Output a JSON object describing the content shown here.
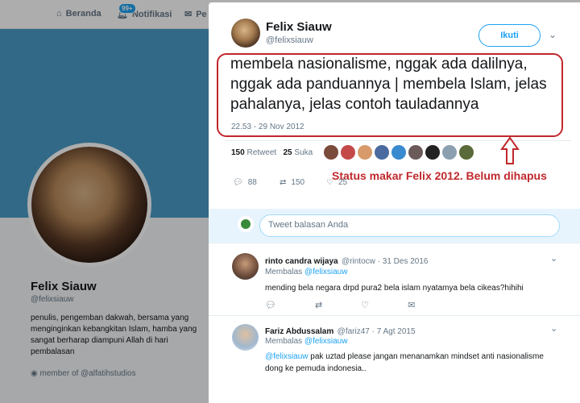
{
  "nav": {
    "home": "Beranda",
    "notif_badge": "99+",
    "notif": "Notifikasi",
    "messages": "Pe"
  },
  "profile": {
    "name": "Felix Siauw",
    "handle": "@felixsiauw",
    "bio": "penulis, pengemban dakwah, bersama yang menginginkan kebangkitan Islam, hamba yang sangat berharap diampuni Allah di hari pembalasan",
    "location": "member of @alfatihstudios"
  },
  "tweet": {
    "author_name": "Felix Siauw",
    "author_handle": "@felixsiauw",
    "follow_label": "Ikuti",
    "text": "membela nasionalisme, nggak ada dalilnya, nggak ada panduannya | membela Islam, jelas pahalanya, jelas contoh tauladannya",
    "time": "22.53 - 29 Nov 2012",
    "retweets": "150",
    "retweet_label": "Retweet",
    "likes": "25",
    "like_label": "Suka",
    "reply_count": "88",
    "retweet_count": "150",
    "like_count": "25"
  },
  "annotation": "Status makar Felix 2012. Belum dihapus",
  "reply_box": {
    "placeholder": "Tweet balasan Anda"
  },
  "replies": [
    {
      "name": "rinto candra wijaya",
      "meta": "@rintocw · 31 Des 2016",
      "to_label": "Membalas",
      "to_handle": "@felixsiauw",
      "text": "mending bela negara drpd pura2 bela islam nyatamya bela cikeas?hihihi"
    },
    {
      "name": "Fariz Abdussalam",
      "meta": "@fariz47 · 7 Agt 2015",
      "to_label": "Membalas",
      "to_handle": "@felixsiauw",
      "mention": "@felixsiauw",
      "text": " pak uztad please jangan menanamkan mindset anti nasionalisme dong ke pemuda indonesia.."
    }
  ],
  "colors": {
    "accent": "#1da1f2",
    "annotation_red": "#c0282c"
  }
}
